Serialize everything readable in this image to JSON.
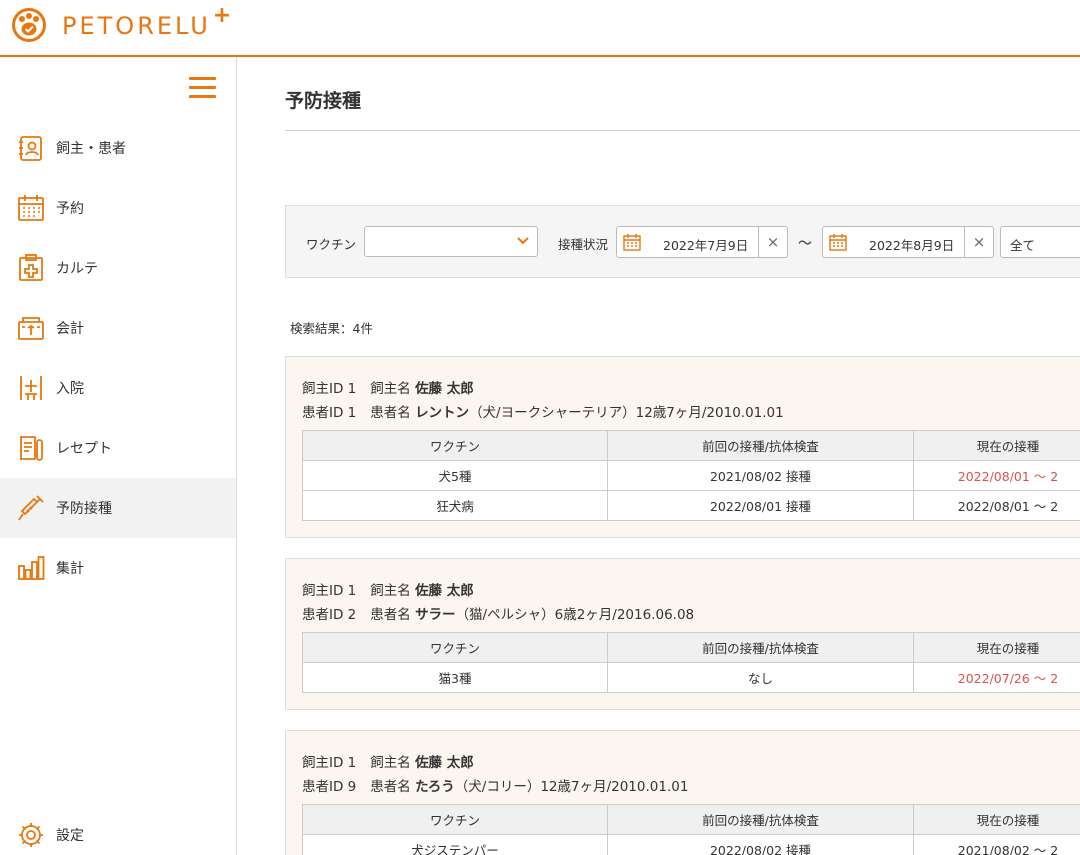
{
  "app": {
    "brand": "PETORELU",
    "brand_plus": "+"
  },
  "colors": {
    "accent": "#e8770f",
    "alert": "#d9534f",
    "card_bg": "#fcf6f0"
  },
  "sidebar": {
    "items": [
      {
        "label": "飼主・患者",
        "icon": "owner-patient-icon"
      },
      {
        "label": "予約",
        "icon": "calendar-icon"
      },
      {
        "label": "カルテ",
        "icon": "medical-chart-icon"
      },
      {
        "label": "会計",
        "icon": "register-icon"
      },
      {
        "label": "入院",
        "icon": "hospitalization-icon"
      },
      {
        "label": "レセプト",
        "icon": "receipt-icon"
      },
      {
        "label": "予防接種",
        "icon": "syringe-icon",
        "active": true
      },
      {
        "label": "集計",
        "icon": "bar-chart-icon"
      }
    ],
    "settings_label": "設定"
  },
  "page": {
    "title": "予防接種"
  },
  "filter": {
    "vaccine_label": "ワクチン",
    "vaccine_value": "",
    "status_label": "接種状況",
    "date_from": "2022年7月9日",
    "tilde": "～",
    "date_to": "2022年8月9日",
    "status_value": "全て"
  },
  "result_count": "検索結果：4件",
  "table_headers": [
    "ワクチン",
    "前回の接種/抗体検査",
    "現在の接種"
  ],
  "cards": [
    {
      "owner_id": "飼主ID 1",
      "owner_name_label": "飼主名",
      "owner_name": "佐藤 太郎",
      "patient_id": "患者ID 1",
      "patient_name_label": "患者名",
      "patient_name": "レントン",
      "patient_detail": "（犬/ヨークシャーテリア）12歳7ヶ月/2010.01.01",
      "rows": [
        {
          "vaccine": "犬5種",
          "previous": "2021/08/02 接種",
          "current": "2022/08/01 ～ 2",
          "alert": true
        },
        {
          "vaccine": "狂犬病",
          "previous": "2022/08/01 接種",
          "current": "2022/08/01 ～ 2",
          "alert": false
        }
      ]
    },
    {
      "owner_id": "飼主ID 1",
      "owner_name_label": "飼主名",
      "owner_name": "佐藤 太郎",
      "patient_id": "患者ID 2",
      "patient_name_label": "患者名",
      "patient_name": "サラー",
      "patient_detail": "（猫/ペルシャ）6歳2ヶ月/2016.06.08",
      "rows": [
        {
          "vaccine": "猫3種",
          "previous": "なし",
          "current": "2022/07/26 ～ 2",
          "alert": true
        }
      ]
    },
    {
      "owner_id": "飼主ID 1",
      "owner_name_label": "飼主名",
      "owner_name": "佐藤 太郎",
      "patient_id": "患者ID 9",
      "patient_name_label": "患者名",
      "patient_name": "たろう",
      "patient_detail": "（犬/コリー）12歳7ヶ月/2010.01.01",
      "rows": [
        {
          "vaccine": "犬ジステンパー",
          "previous": "2022/08/02 接種",
          "current": "2021/08/02 ～ 2",
          "alert": false
        }
      ]
    }
  ]
}
